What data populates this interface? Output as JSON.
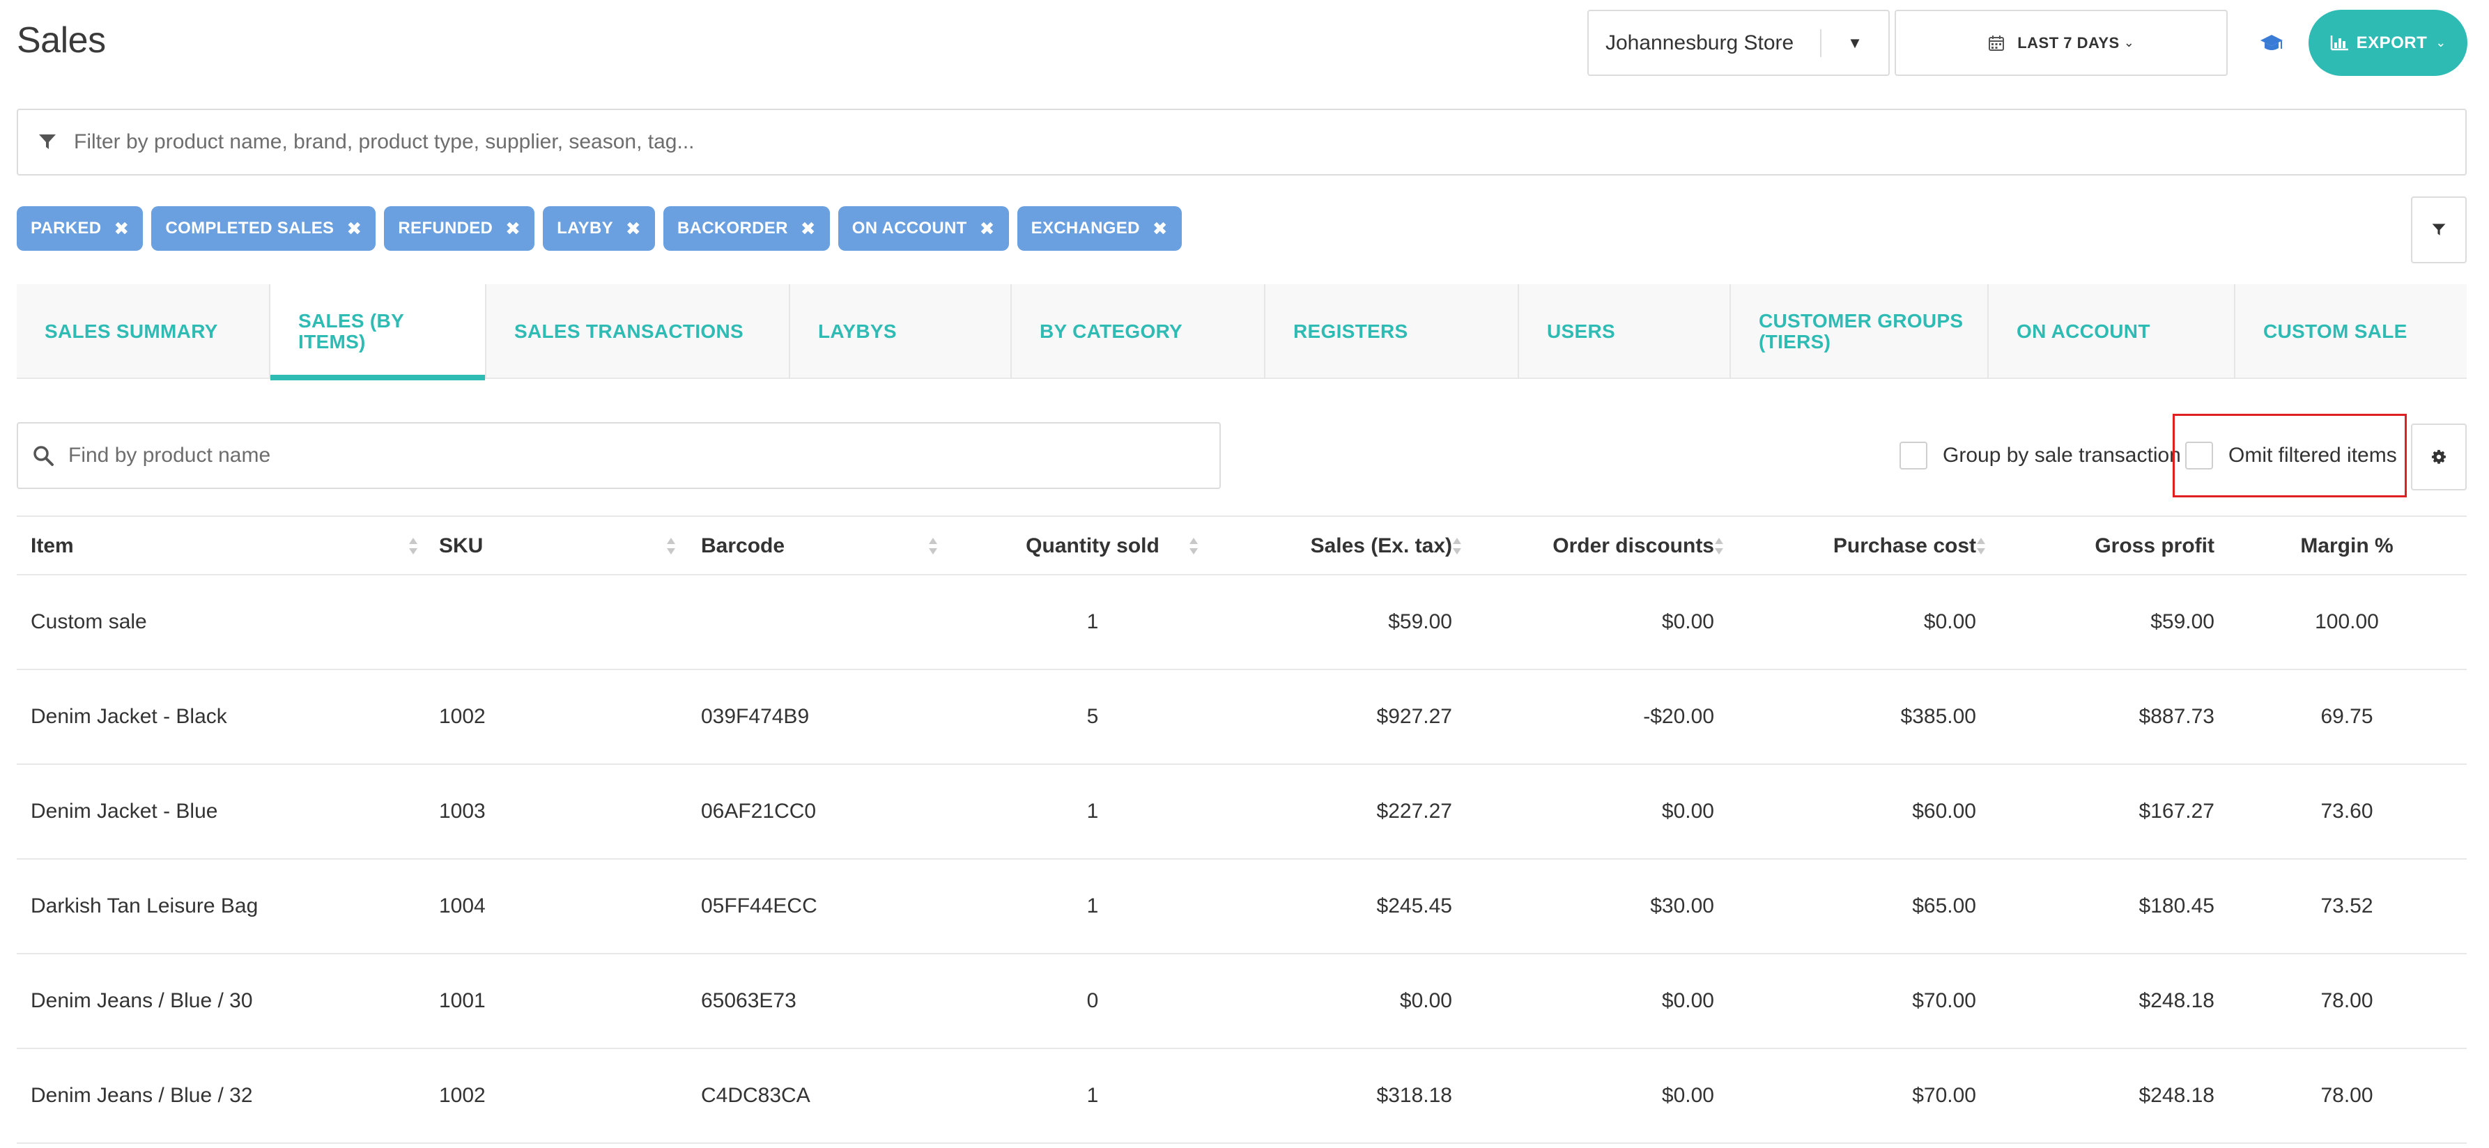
{
  "header": {
    "title": "Sales",
    "store": "Johannesburg Store",
    "date_range": "LAST 7 DAYS",
    "export_label": "EXPORT"
  },
  "filter": {
    "placeholder": "Filter by product name, brand, product type, supplier, season, tag..."
  },
  "chips": [
    "PARKED",
    "COMPLETED SALES",
    "REFUNDED",
    "LAYBY",
    "BACKORDER",
    "ON ACCOUNT",
    "EXCHANGED"
  ],
  "tabs": [
    {
      "label": "SALES SUMMARY",
      "active": false
    },
    {
      "label": "SALES (BY ITEMS)",
      "active": true
    },
    {
      "label": "SALES TRANSACTIONS",
      "active": false
    },
    {
      "label": "LAYBYS",
      "active": false
    },
    {
      "label": "BY CATEGORY",
      "active": false
    },
    {
      "label": "REGISTERS",
      "active": false
    },
    {
      "label": "USERS",
      "active": false
    },
    {
      "label": "CUSTOMER GROUPS (TIERS)",
      "active": false
    },
    {
      "label": "ON ACCOUNT",
      "active": false
    },
    {
      "label": "CUSTOM SALE",
      "active": false
    }
  ],
  "search": {
    "placeholder": "Find by product name"
  },
  "options": {
    "group_by": {
      "label": "Group by sale transaction",
      "checked": false
    },
    "omit_filtered": {
      "label": "Omit filtered items",
      "checked": false
    }
  },
  "table": {
    "columns": [
      "Item",
      "SKU",
      "Barcode",
      "Quantity sold",
      "Sales (Ex. tax)",
      "Order discounts",
      "Purchase cost",
      "Gross profit",
      "Margin %"
    ],
    "rows": [
      [
        "Custom sale",
        "",
        "",
        "1",
        "$59.00",
        "$0.00",
        "$0.00",
        "$59.00",
        "100.00"
      ],
      [
        "Denim Jacket - Black",
        "1002",
        "039F474B9",
        "5",
        "$927.27",
        "-$20.00",
        "$385.00",
        "$887.73",
        "69.75"
      ],
      [
        "Denim Jacket - Blue",
        "1003",
        "06AF21CC0",
        "1",
        "$227.27",
        "$0.00",
        "$60.00",
        "$167.27",
        "73.60"
      ],
      [
        "Darkish Tan Leisure Bag",
        "1004",
        "05FF44ECC",
        "1",
        "$245.45",
        "$30.00",
        "$65.00",
        "$180.45",
        "73.52"
      ],
      [
        "Denim Jeans / Blue / 30",
        "1001",
        "65063E73",
        "0",
        "$0.00",
        "$0.00",
        "$70.00",
        "$248.18",
        "78.00"
      ],
      [
        "Denim Jeans / Blue / 32",
        "1002",
        "C4DC83CA",
        "1",
        "$318.18",
        "$0.00",
        "$70.00",
        "$248.18",
        "78.00"
      ]
    ]
  },
  "colors": {
    "accent": "#2ebbb4",
    "chip": "#6a9fe0",
    "highlight": "#e02020"
  }
}
